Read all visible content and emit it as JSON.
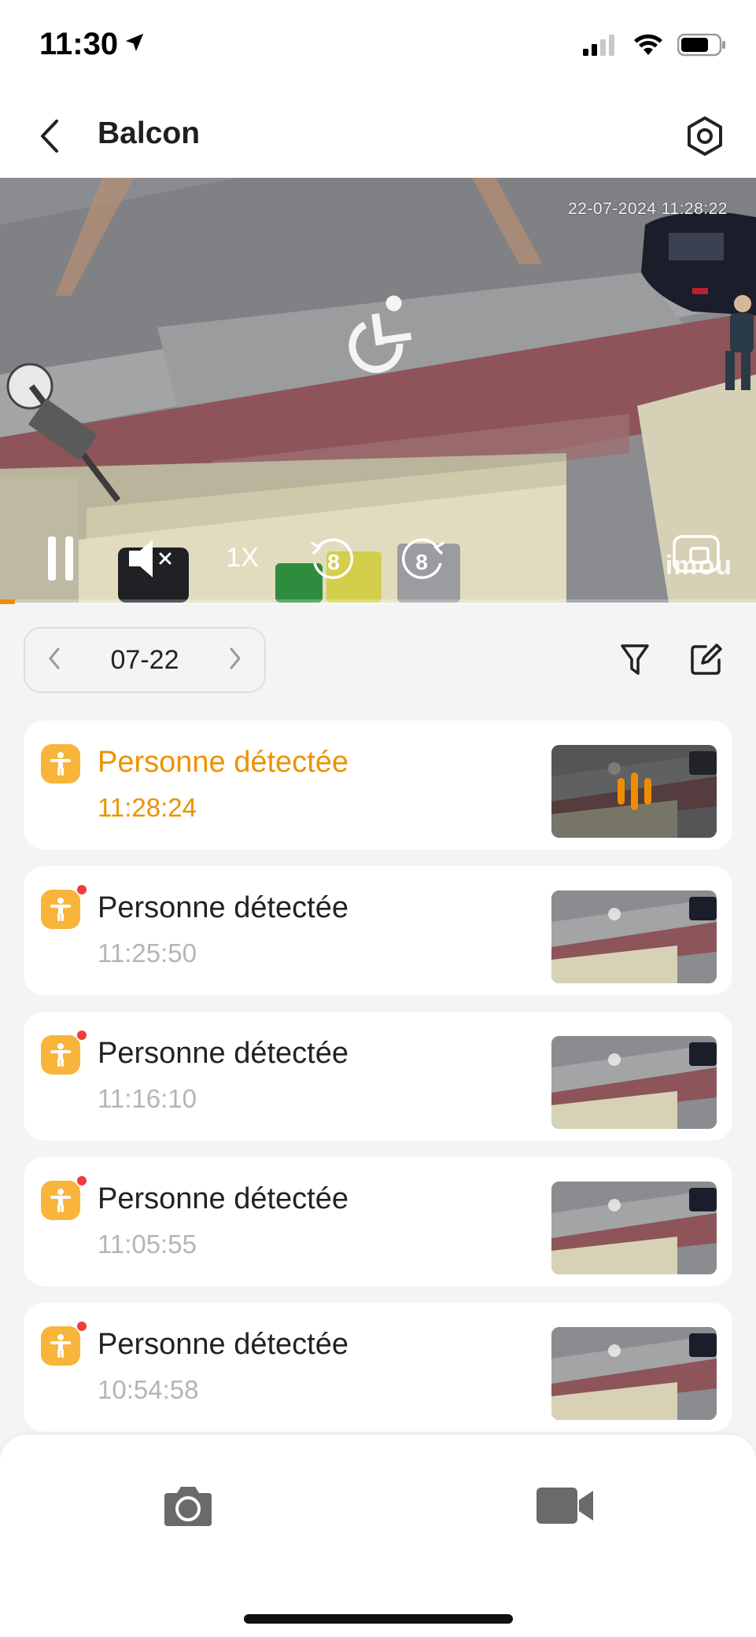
{
  "status_bar": {
    "time": "11:30",
    "icons": [
      "location-arrow-icon",
      "signal-icon",
      "wifi-icon",
      "battery-icon"
    ]
  },
  "header": {
    "title": "Balcon",
    "back_icon": "chevron-left-icon",
    "settings_icon": "settings-hexagon-icon"
  },
  "video": {
    "timestamp": "22-07-2024 11:28:22",
    "speed": "1X",
    "rewind_label": "8",
    "forward_label": "8",
    "watermark": "imou",
    "progress": 0.02,
    "controls": [
      "pause-icon",
      "mute-icon",
      "rewind-8-icon",
      "forward-8-icon",
      "fullscreen-icon"
    ]
  },
  "date_selector": {
    "date": "07-22"
  },
  "events": [
    {
      "title": "Personne détectée",
      "time": "11:28:24",
      "active": true,
      "unread": false
    },
    {
      "title": "Personne détectée",
      "time": "11:25:50",
      "active": false,
      "unread": true
    },
    {
      "title": "Personne détectée",
      "time": "11:16:10",
      "active": false,
      "unread": true
    },
    {
      "title": "Personne détectée",
      "time": "11:05:55",
      "active": false,
      "unread": true
    },
    {
      "title": "Personne détectée",
      "time": "10:54:58",
      "active": false,
      "unread": true
    }
  ],
  "colors": {
    "accent": "#ec9200",
    "event_icon": "#f9b43b",
    "unread_dot": "#f23b3b",
    "muted_time": "#b5b5b5"
  },
  "bottom_bar": {
    "icons": [
      "camera-snapshot-icon",
      "video-record-icon"
    ]
  }
}
